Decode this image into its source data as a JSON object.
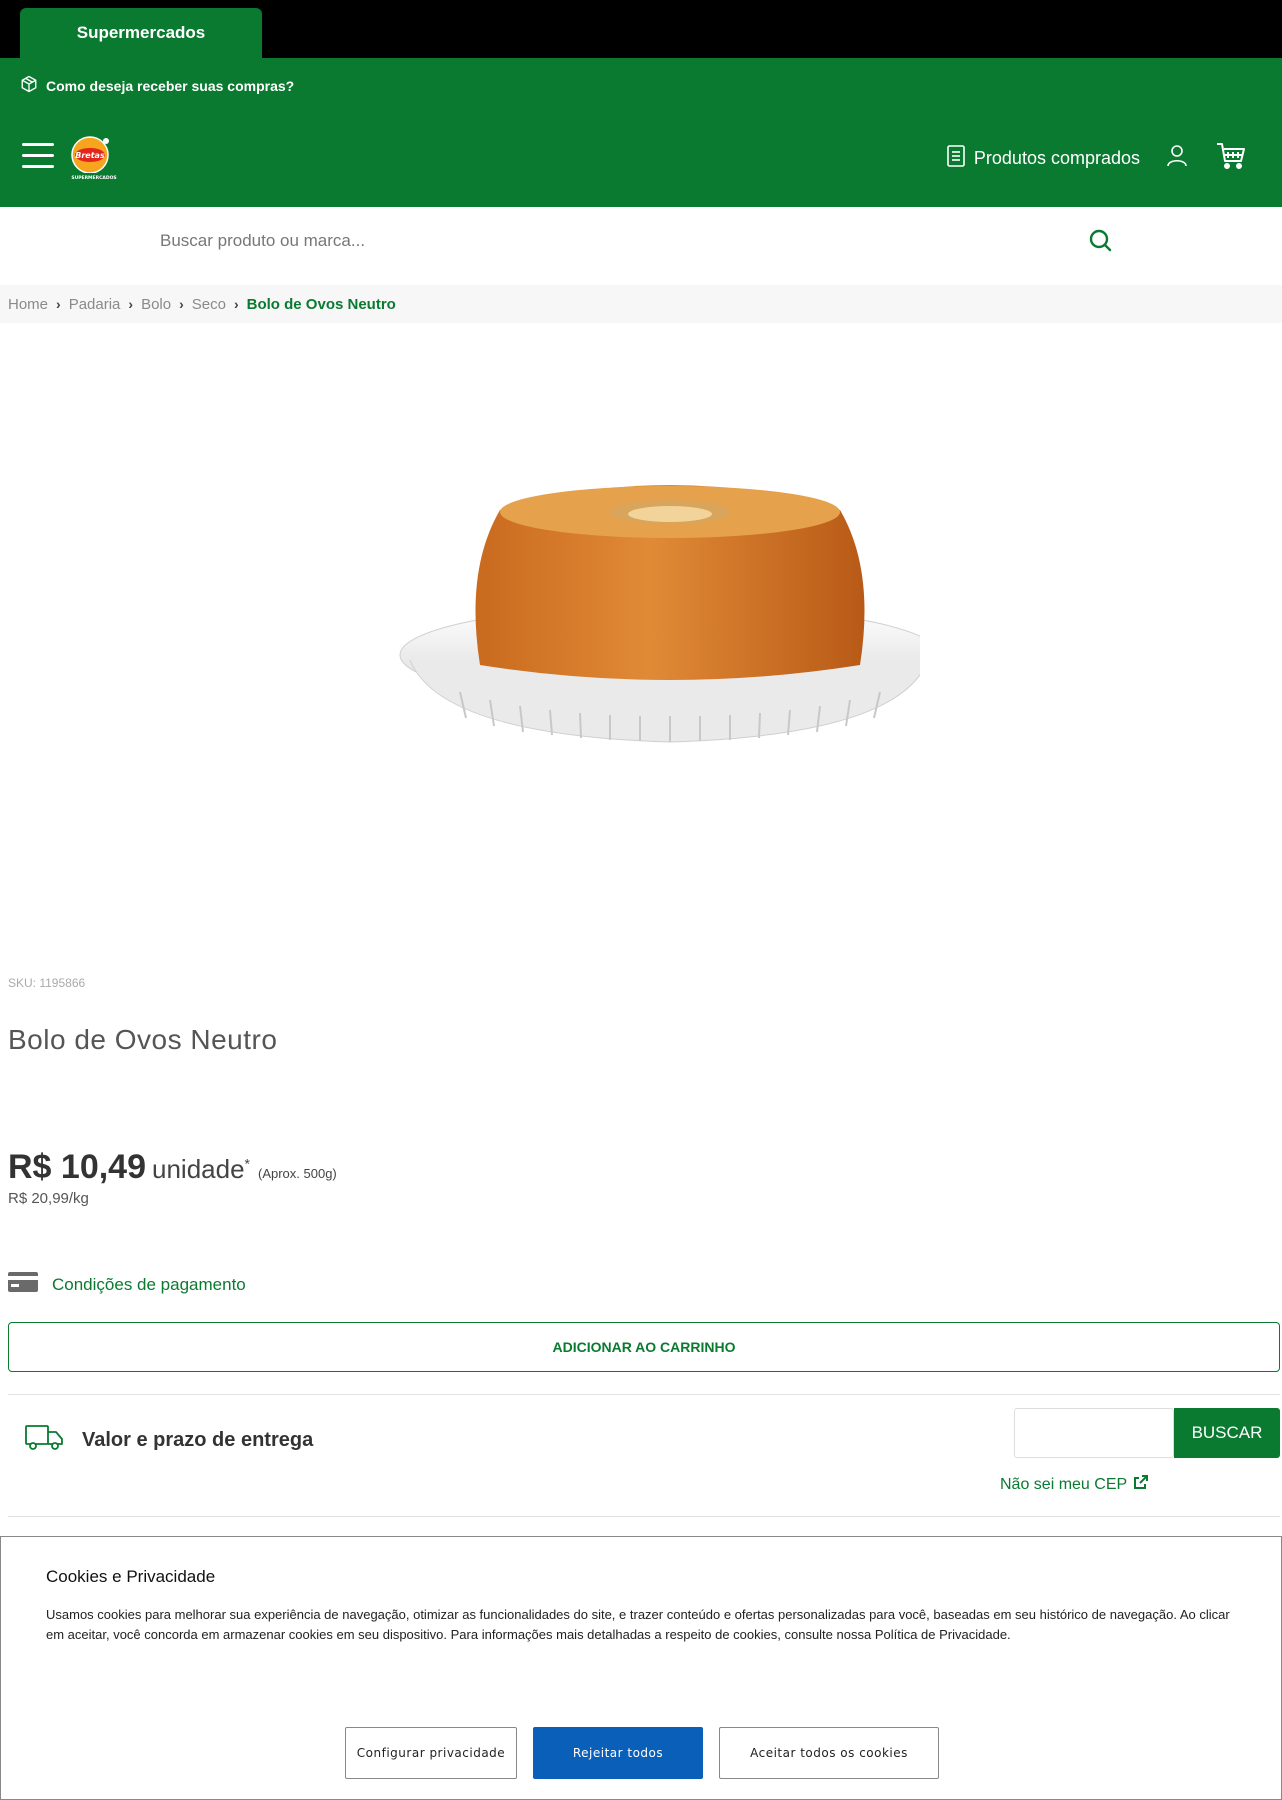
{
  "topbar": {
    "tab_label": "Supermercados"
  },
  "delivery": {
    "question": "Como deseja receber suas compras?"
  },
  "header": {
    "purchased_label": "Produtos comprados",
    "logo_text": "Bretas",
    "logo_sub": "SUPERMERCADOS"
  },
  "search": {
    "placeholder": "Buscar produto ou marca..."
  },
  "breadcrumb": {
    "items": [
      "Home",
      "Padaria",
      "Bolo",
      "Seco"
    ],
    "current": "Bolo de Ovos Neutro",
    "separator": "›"
  },
  "product": {
    "sku": "SKU: 1195866",
    "title": "Bolo de Ovos Neutro",
    "price": "R$ 10,49",
    "unit": "unidade",
    "unit_mark": "*",
    "approx": "(Aprox. 500g)",
    "price_per_kg": "R$ 20,99/kg",
    "payment_label": "Condições de pagamento",
    "add_to_cart": "ADICIONAR AO CARRINHO"
  },
  "shipping": {
    "label": "Valor e prazo de entrega",
    "cep_placeholder": "",
    "search_button": "BUSCAR",
    "no_cep": "Não sei meu CEP"
  },
  "cookies": {
    "title": "Cookies e Privacidade",
    "text": "Usamos cookies para melhorar sua experiência de navegação, otimizar as funcionalidades do site, e trazer conteúdo e ofertas personalizadas para você, baseadas em seu histórico de navegação. Ao clicar em aceitar, você concorda em armazenar cookies em seu dispositivo. Para informações mais detalhadas a respeito de cookies, consulte nossa Política de Privacidade.",
    "configure": "Configurar privacidade",
    "reject": "Rejeitar todos",
    "accept": "Aceitar todos os cookies"
  },
  "colors": {
    "brand_green": "#0a7a31",
    "reject_blue": "#0a5fb8"
  }
}
